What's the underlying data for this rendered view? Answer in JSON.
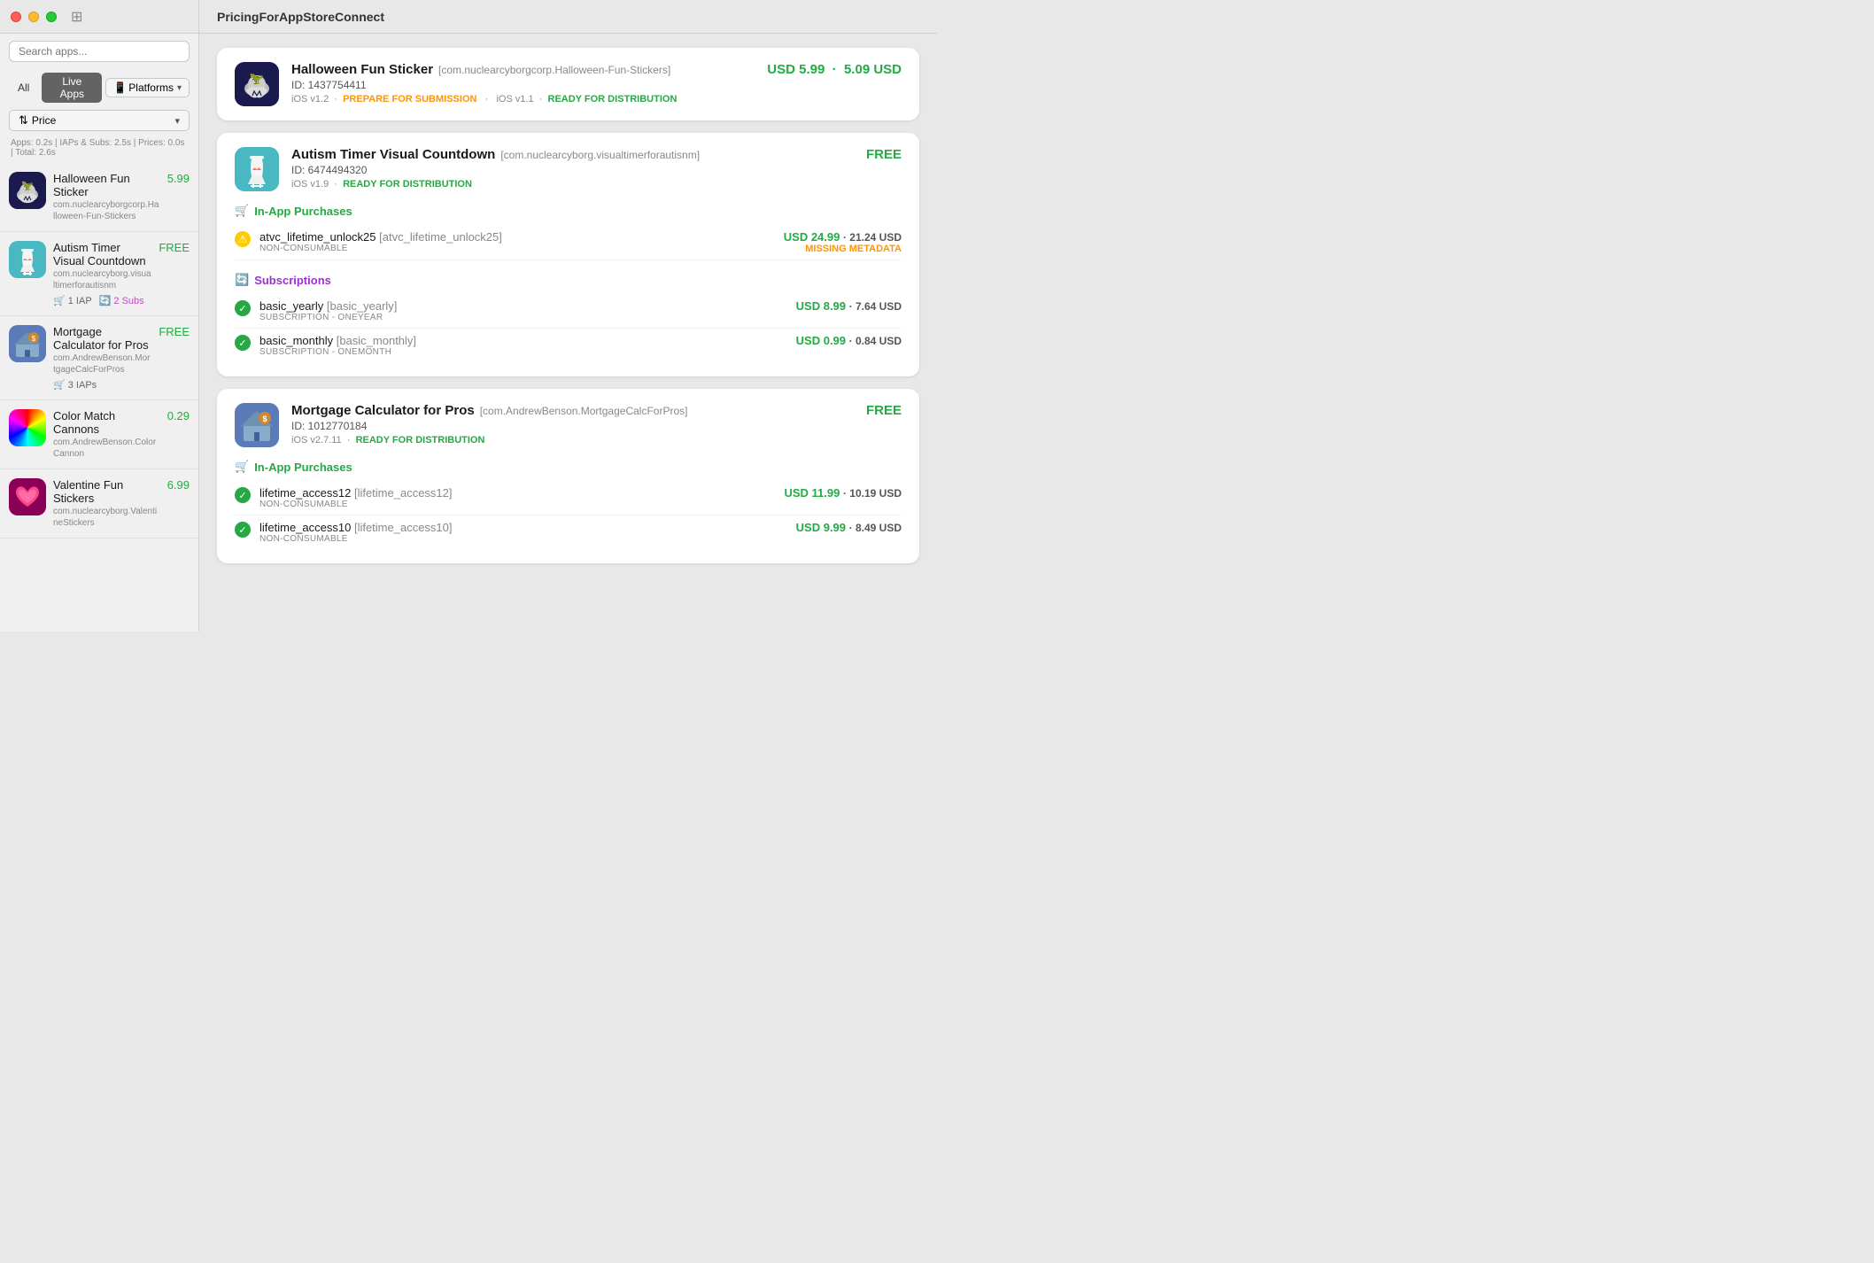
{
  "window": {
    "title": "PricingForAppStoreConnect"
  },
  "sidebar": {
    "search_placeholder": "Search apps...",
    "filter_all": "All",
    "filter_live": "Live Apps",
    "filter_platforms": "Platforms",
    "sort_label": "Price",
    "stats": "Apps: 0.2s | IAPs & Subs: 2.5s | Prices: 0.0s | Total: 2.6s"
  },
  "apps": [
    {
      "id": "app-halloween",
      "name": "Halloween Fun Sticker",
      "bundle": "com.nuclearcyborgcorp.Halloween-Fun-Stickers",
      "price": "5.99",
      "price_color": "green",
      "iap_count": null,
      "sub_count": null,
      "icon_type": "halloween"
    },
    {
      "id": "app-autism",
      "name": "Autism Timer Visual Countdown",
      "bundle": "com.nuclearcyborg.visualtimerforautisnm",
      "price": "FREE",
      "price_color": "green",
      "iap_count": "1 IAP",
      "sub_count": "2 Subs",
      "icon_type": "autism"
    },
    {
      "id": "app-mortgage",
      "name": "Mortgage Calculator for Pros",
      "bundle": "com.AndrewBenson.MortgageCalcForPros",
      "price": "FREE",
      "price_color": "green",
      "iap_count": "3 IAPs",
      "sub_count": null,
      "icon_type": "mortgage"
    },
    {
      "id": "app-color",
      "name": "Color Match Cannons",
      "bundle": "com.AndrewBenson.ColorCannon",
      "price": "0.29",
      "price_color": "green",
      "iap_count": null,
      "sub_count": null,
      "icon_type": "color"
    },
    {
      "id": "app-valentine",
      "name": "Valentine Fun Stickers",
      "bundle": "com.nuclearcyborg.ValentineStickers",
      "price": "6.99",
      "price_color": "green",
      "iap_count": null,
      "sub_count": null,
      "icon_type": "valentine"
    }
  ],
  "cards": [
    {
      "id": "card-halloween",
      "name": "Halloween Fun Sticker",
      "bundle": "com.nuclearcyborgcorp.Halloween-Fun-Stickers",
      "app_id": "ID: 1437754411",
      "price": "USD 5.99 • 5.09 USD",
      "icon_type": "halloween",
      "versions": [
        {
          "version": "iOS v1.2",
          "status": "PREPARE FOR SUBMISSION",
          "status_color": "orange"
        },
        {
          "version": "iOS v1.1",
          "status": "READY FOR DISTRIBUTION",
          "status_color": "green"
        }
      ],
      "iaps": [],
      "subscriptions": []
    },
    {
      "id": "card-autism",
      "name": "Autism Timer Visual Countdown",
      "bundle": "com.nuclearcyborg.visualtimerforautisnm",
      "app_id": "ID: 6474494320",
      "price": "FREE",
      "icon_type": "autism",
      "versions": [
        {
          "version": "iOS v1.9",
          "status": "READY FOR DISTRIBUTION",
          "status_color": "green"
        }
      ],
      "iaps": [
        {
          "id": "iap-atvc",
          "name": "atvc_lifetime_unlock25",
          "bundle_id": "atvc_lifetime_unlock25",
          "type": "NON-CONSUMABLE",
          "price": "USD 24.99",
          "price_usd": "21.24 USD",
          "status": "warning",
          "status_label": "MISSING METADATA"
        }
      ],
      "subscriptions": [
        {
          "id": "sub-basic-yearly",
          "name": "basic_yearly",
          "bundle_id": "basic_yearly",
          "type": "SUBSCRIPTION - oneYear",
          "price": "USD 8.99",
          "price_usd": "7.64 USD",
          "status": "active"
        },
        {
          "id": "sub-basic-monthly",
          "name": "basic_monthly",
          "bundle_id": "basic_monthly",
          "type": "SUBSCRIPTION - oneMonth",
          "price": "USD 0.99",
          "price_usd": "0.84 USD",
          "status": "active"
        }
      ]
    },
    {
      "id": "card-mortgage",
      "name": "Mortgage Calculator for Pros",
      "bundle": "com.AndrewBenson.MortgageCalcForPros",
      "app_id": "ID: 1012770184",
      "price": "FREE",
      "icon_type": "mortgage",
      "versions": [
        {
          "version": "iOS v2.7.11",
          "status": "READY FOR DISTRIBUTION",
          "status_color": "green"
        }
      ],
      "iaps": [
        {
          "id": "iap-lifetime12",
          "name": "lifetime_access12",
          "bundle_id": "lifetime_access12",
          "type": "NON-CONSUMABLE",
          "price": "USD 11.99",
          "price_usd": "10.19 USD",
          "status": "active",
          "status_label": ""
        },
        {
          "id": "iap-lifetime10",
          "name": "lifetime_access10",
          "bundle_id": "lifetime_access10",
          "type": "NON-CONSUMABLE",
          "price": "USD 9.99",
          "price_usd": "8.49 USD",
          "status": "active",
          "status_label": ""
        }
      ],
      "subscriptions": []
    }
  ],
  "labels": {
    "in_app_purchases": "In-App Purchases",
    "subscriptions": "Subscriptions",
    "missing_metadata": "MISSING METADATA"
  }
}
